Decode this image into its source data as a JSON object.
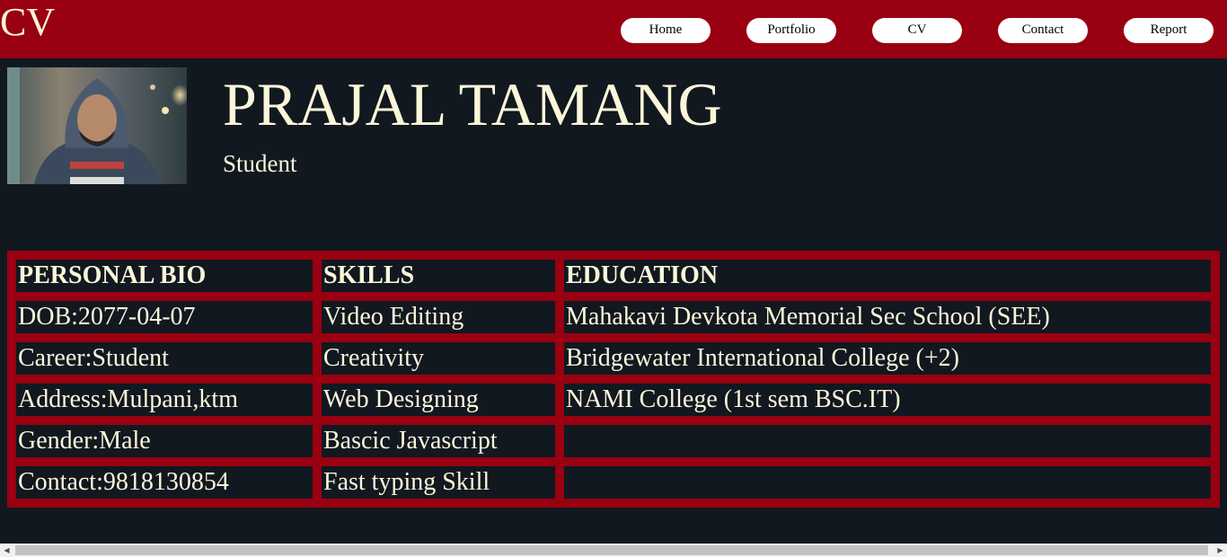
{
  "header": {
    "logo": "CV",
    "nav": [
      "Home",
      "Portfolio",
      "CV",
      "Contact",
      "Report"
    ]
  },
  "profile": {
    "name": "PRAJAL TAMANG",
    "role": "Student"
  },
  "table": {
    "headers": [
      "PERSONAL BIO",
      "SKILLS",
      "EDUCATION"
    ],
    "rows": [
      [
        "DOB:2077-04-07",
        "Video Editing",
        "Mahakavi Devkota Memorial Sec School (SEE)"
      ],
      [
        "Career:Student",
        "Creativity",
        "Bridgewater International College (+2)"
      ],
      [
        "Address:Mulpani,ktm",
        "Web Designing",
        "NAMI College (1st sem BSC.IT)"
      ],
      [
        "Gender:Male",
        "Bascic Javascript",
        ""
      ],
      [
        "Contact:9818130854",
        "Fast typing Skill",
        ""
      ]
    ]
  },
  "colors": {
    "brand": "#990011",
    "text": "#FCF6D9",
    "background": "#111820"
  }
}
